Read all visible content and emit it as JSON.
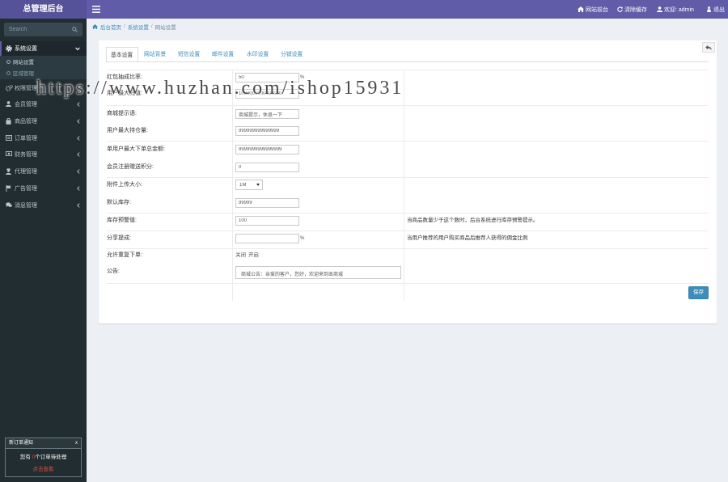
{
  "app": {
    "title": "总管理后台"
  },
  "navbar": {
    "items": [
      {
        "icon": "home-icon",
        "label": "网站前台"
      },
      {
        "icon": "refresh-icon",
        "label": "清除缓存"
      },
      {
        "icon": "user-icon",
        "label": "欢迎: admin"
      },
      {
        "icon": "sign-out-icon",
        "label": "退出"
      }
    ]
  },
  "sidebar": {
    "search": {
      "placeholder": "Search",
      "value": ""
    },
    "menu": [
      {
        "label": "系统设置",
        "icon": "gear-icon",
        "expanded": true,
        "children": [
          {
            "label": "网站设置",
            "active": true
          },
          {
            "label": "区域管理"
          }
        ]
      },
      {
        "label": "权限管理",
        "icon": "cogs-icon"
      },
      {
        "label": "会员管理",
        "icon": "user-icon"
      },
      {
        "label": "商品管理",
        "icon": "shopping-bag-icon"
      },
      {
        "label": "订单管理",
        "icon": "list-alt-icon"
      },
      {
        "label": "财务管理",
        "icon": "money-icon"
      },
      {
        "label": "代理管理",
        "icon": "user-secret-icon"
      },
      {
        "label": "广告管理",
        "icon": "flag-icon"
      },
      {
        "label": "消息管理",
        "icon": "comments-icon"
      }
    ],
    "notice": {
      "title": "新订单通知",
      "close": "x",
      "text_prefix": "您有",
      "count": "0",
      "text_suffix": "个订单待处理",
      "link": "点击查看"
    }
  },
  "breadcrumb": {
    "items": [
      "后台首页",
      "系统设置",
      "网站设置"
    ],
    "separator": "/"
  },
  "tabs": [
    {
      "label": "基本设置",
      "active": true
    },
    {
      "label": "网站背景"
    },
    {
      "label": "短信设置"
    },
    {
      "label": "邮件设置"
    },
    {
      "label": "水印设置"
    },
    {
      "label": "分销设置"
    }
  ],
  "form": {
    "rows": [
      {
        "label": "红包抽成比率:",
        "value": "50",
        "suffix": "%"
      },
      {
        "label": "用户最大充值:",
        "value": "1000000000000000"
      },
      {
        "label": "商城提示语:",
        "value": "商城提示，休息一下"
      },
      {
        "label": "用户最大持仓量:",
        "value": "999999999999999"
      },
      {
        "label": "单用户最大下单总金额:",
        "value": "9999999999999999"
      },
      {
        "label": "会员注册赠送积分:",
        "value": "0"
      },
      {
        "label": "附件上传大小:",
        "value": "1M"
      },
      {
        "label": "默认库存:",
        "value": "99999"
      },
      {
        "label": "库存预警值:",
        "value": "100",
        "help": "当商品数量少于这个数时，后台系统进行库存预警提示。"
      },
      {
        "label": "分享提成:",
        "value": "",
        "suffix": "%",
        "help": "当用户推荐的用户购买商品后推荐人获得的佣金比例"
      },
      {
        "label": "允许重复下单:",
        "options": [
          "关闭",
          "开启"
        ]
      },
      {
        "label": "公告:",
        "value": "商城公告：亲爱的客户，您好，欢迎来到本商城"
      }
    ]
  },
  "actions": {
    "save_label": "保存"
  },
  "watermark": "https://www.huzhan.com/ishop15931",
  "colors": {
    "navbar": "#605ca8",
    "logo": "#555299",
    "sidebar": "#222d32",
    "primary": "#3c8dbc",
    "alert": "#dd4b39",
    "page_bg": "#ecf0f5"
  }
}
